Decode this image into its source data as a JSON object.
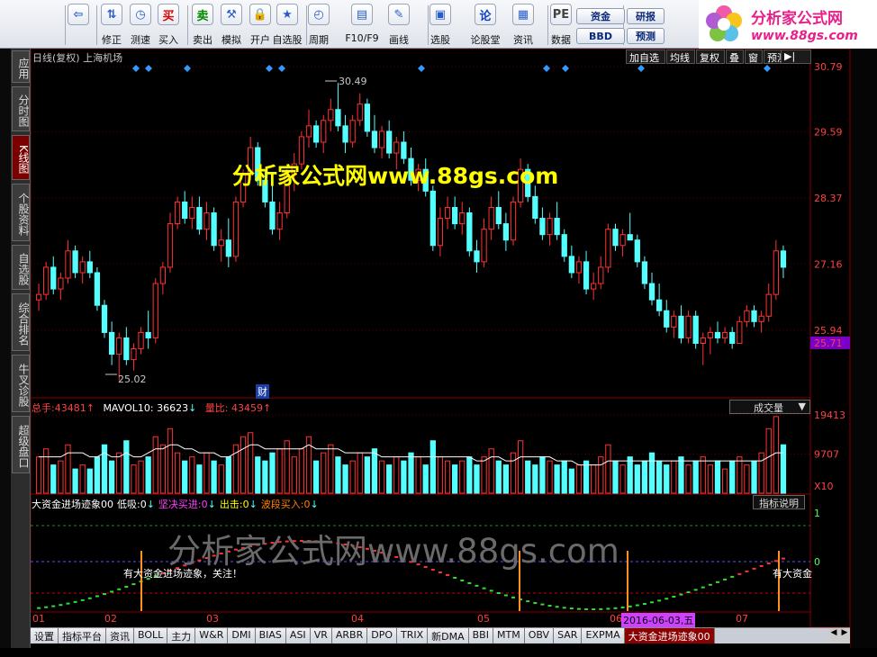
{
  "toolbar": {
    "buttons": [
      {
        "label": "",
        "icon": "back-arrow"
      },
      {
        "label": "修正",
        "icon": "up-down-arrows"
      },
      {
        "label": "测速",
        "icon": "clock"
      },
      {
        "label": "买入",
        "icon": "买"
      },
      {
        "label": "卖出",
        "icon": "卖"
      },
      {
        "label": "模拟",
        "icon": "hammer"
      },
      {
        "label": "开户",
        "icon": "lock"
      },
      {
        "label": "自选股",
        "icon": "star-folder"
      },
      {
        "label": "周期",
        "icon": "clock-dropdown"
      },
      {
        "label": "F10/F9",
        "icon": "document"
      },
      {
        "label": "画线",
        "icon": "pencil"
      },
      {
        "label": "选股",
        "icon": "monitor"
      },
      {
        "label": "论股堂",
        "icon": "论"
      },
      {
        "label": "资讯",
        "icon": "news"
      },
      {
        "label": "数据",
        "icon": "PE"
      }
    ],
    "pill_zijin": "资金",
    "pill_bbd": "BBD",
    "pill_yanbao": "研报",
    "pill_yuce": "预测",
    "pe_label": "PE"
  },
  "logo": {
    "title": "分析家公式网",
    "url": "www.88gs.com"
  },
  "sidebar": [
    "应用",
    "分时图",
    "K线图",
    "个股资料",
    "自选股",
    "综合排名",
    "牛叉诊股",
    "超级盘口"
  ],
  "chart_header": {
    "title": "日线(复权) 上海机场",
    "buttons": [
      "加自选",
      "均线",
      "复权",
      "叠",
      "窗",
      "预测"
    ]
  },
  "watermark_top": "分析家公式网www.88gs.com",
  "watermark_mid": "分析家公式网www.88gs.com",
  "price_labels": {
    "high": "30.49",
    "low": "25.02"
  },
  "cai_badge": "财",
  "volume_header": {
    "zongshou_label": "总手:",
    "zongshou": "43481",
    "mavol_label": "MAVOL10:",
    "mavol": "36623",
    "liangbi_label": "量比:",
    "liangbi": "43459",
    "select": "成交量"
  },
  "indicator_header": {
    "name": "大资金进场迹象00",
    "items": [
      {
        "label": "低吸:",
        "value": "0",
        "color": "#ffffff"
      },
      {
        "label": "坚决买进:",
        "value": "0",
        "color": "#ff40ff"
      },
      {
        "label": "出击:",
        "value": "0",
        "color": "#ffff00"
      },
      {
        "label": "波段买入:",
        "value": "0",
        "color": "#ff8000"
      }
    ],
    "help": "指标说明"
  },
  "indicator_notes": {
    "note1": "有大资金进场迹象，关注！",
    "note2": "有大资金"
  },
  "x_axis": {
    "months": [
      "01",
      "02",
      "03",
      "04",
      "05",
      "06",
      "07"
    ],
    "cursor_date": "2016-06-03,五"
  },
  "tabs": [
    "设置",
    "指标平台",
    "资讯",
    "BOLL",
    "主力",
    "W&R",
    "DMI",
    "BIAS",
    "ASI",
    "VR",
    "ARBR",
    "DPO",
    "TRIX",
    "新DMA",
    "BBI",
    "MTM",
    "OBV",
    "SAR",
    "EXPMA",
    "大资金进场迹象00"
  ],
  "chart_data": {
    "type": "candlestick",
    "title": "日线(复权) 上海机场",
    "price_axis": {
      "ticks": [
        "30.79",
        "29.59",
        "28.37",
        "27.16",
        "25.94"
      ],
      "current": "25.71"
    },
    "volume_axis": {
      "ticks": [
        "19413",
        "9707"
      ],
      "unit": "X10"
    },
    "indicator_axis": {
      "ticks": [
        "1",
        "0"
      ]
    },
    "x_labels": [
      "01",
      "02",
      "03",
      "04",
      "05",
      "06",
      "07"
    ],
    "high": 30.49,
    "low": 25.02,
    "candles": [
      [
        26.5,
        26.8,
        26.3,
        26.6
      ],
      [
        26.6,
        27.2,
        26.5,
        27.1
      ],
      [
        27.1,
        27.3,
        26.6,
        26.7
      ],
      [
        26.7,
        27.0,
        26.5,
        26.9
      ],
      [
        26.9,
        27.6,
        26.8,
        27.4
      ],
      [
        27.4,
        27.5,
        26.9,
        27.0
      ],
      [
        27.0,
        27.3,
        26.8,
        27.2
      ],
      [
        27.2,
        27.4,
        26.9,
        27.0
      ],
      [
        27.0,
        27.1,
        26.3,
        26.4
      ],
      [
        26.4,
        26.5,
        25.8,
        25.9
      ],
      [
        25.9,
        26.1,
        25.3,
        25.5
      ],
      [
        25.5,
        25.9,
        25.02,
        25.8
      ],
      [
        25.8,
        26.0,
        25.3,
        25.4
      ],
      [
        25.4,
        25.7,
        25.2,
        25.6
      ],
      [
        25.6,
        26.0,
        25.5,
        25.9
      ],
      [
        25.9,
        26.3,
        25.6,
        25.8
      ],
      [
        25.8,
        26.9,
        25.7,
        26.8
      ],
      [
        26.8,
        27.2,
        26.6,
        27.1
      ],
      [
        27.1,
        28.1,
        27.0,
        27.9
      ],
      [
        27.9,
        28.4,
        27.8,
        28.3
      ],
      [
        28.3,
        28.5,
        27.9,
        28.0
      ],
      [
        28.0,
        28.4,
        27.8,
        28.2
      ],
      [
        28.2,
        28.4,
        27.7,
        27.8
      ],
      [
        27.8,
        28.3,
        27.6,
        28.1
      ],
      [
        28.1,
        28.2,
        27.4,
        27.5
      ],
      [
        27.5,
        27.8,
        27.2,
        27.6
      ],
      [
        27.6,
        28.0,
        27.1,
        27.3
      ],
      [
        27.3,
        28.4,
        27.2,
        28.3
      ],
      [
        28.3,
        28.9,
        28.2,
        28.8
      ],
      [
        28.8,
        29.5,
        28.7,
        29.3
      ],
      [
        29.3,
        29.4,
        28.6,
        28.7
      ],
      [
        28.7,
        28.9,
        28.2,
        28.3
      ],
      [
        28.3,
        28.8,
        27.7,
        27.8
      ],
      [
        27.8,
        28.3,
        27.6,
        28.1
      ],
      [
        28.1,
        28.9,
        28.0,
        28.8
      ],
      [
        28.8,
        29.2,
        28.5,
        29.0
      ],
      [
        29.0,
        29.6,
        28.9,
        29.5
      ],
      [
        29.5,
        30.0,
        29.3,
        29.7
      ],
      [
        29.7,
        29.8,
        29.3,
        29.4
      ],
      [
        29.4,
        29.9,
        29.2,
        29.8
      ],
      [
        29.8,
        30.2,
        29.6,
        30.0
      ],
      [
        30.0,
        30.49,
        29.6,
        29.7
      ],
      [
        29.7,
        29.9,
        29.2,
        29.4
      ],
      [
        29.4,
        29.9,
        29.3,
        29.8
      ],
      [
        29.8,
        30.3,
        29.7,
        30.1
      ],
      [
        30.1,
        30.2,
        29.5,
        29.6
      ],
      [
        29.6,
        29.9,
        29.2,
        29.3
      ],
      [
        29.3,
        29.7,
        29.1,
        29.6
      ],
      [
        29.6,
        29.8,
        29.1,
        29.2
      ],
      [
        29.2,
        29.5,
        28.9,
        29.4
      ],
      [
        29.4,
        29.6,
        29.0,
        29.1
      ],
      [
        29.1,
        29.3,
        28.6,
        28.7
      ],
      [
        28.7,
        29.0,
        28.5,
        28.9
      ],
      [
        28.9,
        29.1,
        28.4,
        28.5
      ],
      [
        28.5,
        28.6,
        27.4,
        27.5
      ],
      [
        27.5,
        28.2,
        27.3,
        28.0
      ],
      [
        28.0,
        28.4,
        27.8,
        28.2
      ],
      [
        28.2,
        28.4,
        27.8,
        27.9
      ],
      [
        27.9,
        28.3,
        27.7,
        28.1
      ],
      [
        28.1,
        28.2,
        27.3,
        27.4
      ],
      [
        27.4,
        27.6,
        27.0,
        27.2
      ],
      [
        27.2,
        28.0,
        27.1,
        27.8
      ],
      [
        27.8,
        28.4,
        27.6,
        28.2
      ],
      [
        28.2,
        28.5,
        27.8,
        27.9
      ],
      [
        27.9,
        28.1,
        27.4,
        27.6
      ],
      [
        27.6,
        28.4,
        27.5,
        28.3
      ],
      [
        28.3,
        29.1,
        28.2,
        28.9
      ],
      [
        28.9,
        29.0,
        28.3,
        28.4
      ],
      [
        28.4,
        28.6,
        27.9,
        28.0
      ],
      [
        28.0,
        28.2,
        27.6,
        27.7
      ],
      [
        27.7,
        28.1,
        27.5,
        28.0
      ],
      [
        28.0,
        28.3,
        27.6,
        27.7
      ],
      [
        27.7,
        27.8,
        27.2,
        27.3
      ],
      [
        27.3,
        27.5,
        26.9,
        27.0
      ],
      [
        27.0,
        27.3,
        26.8,
        27.2
      ],
      [
        27.2,
        27.4,
        26.6,
        26.7
      ],
      [
        26.7,
        27.0,
        26.5,
        26.8
      ],
      [
        26.8,
        27.3,
        26.7,
        27.1
      ],
      [
        27.1,
        27.9,
        27.0,
        27.8
      ],
      [
        27.8,
        27.9,
        27.4,
        27.5
      ],
      [
        27.5,
        27.8,
        27.3,
        27.7
      ],
      [
        27.7,
        28.1,
        27.6,
        27.6
      ],
      [
        27.6,
        27.7,
        27.1,
        27.2
      ],
      [
        27.2,
        27.3,
        26.7,
        26.8
      ],
      [
        26.8,
        27.0,
        26.4,
        26.5
      ],
      [
        26.5,
        26.8,
        26.2,
        26.3
      ],
      [
        26.3,
        26.5,
        25.9,
        26.0
      ],
      [
        26.0,
        26.3,
        25.8,
        26.2
      ],
      [
        26.2,
        26.4,
        25.7,
        25.8
      ],
      [
        25.8,
        26.3,
        25.7,
        26.2
      ],
      [
        26.2,
        26.3,
        25.6,
        25.7
      ],
      [
        25.7,
        25.9,
        25.3,
        25.8
      ],
      [
        25.8,
        26.0,
        25.5,
        25.9
      ],
      [
        25.9,
        26.1,
        25.7,
        25.8
      ],
      [
        25.8,
        26.0,
        25.7,
        25.9
      ],
      [
        25.9,
        26.0,
        25.6,
        25.7
      ],
      [
        25.7,
        26.2,
        25.7,
        26.1
      ],
      [
        26.1,
        26.4,
        26.0,
        26.3
      ],
      [
        26.3,
        26.4,
        26.0,
        26.1
      ],
      [
        26.1,
        26.3,
        25.9,
        26.2
      ],
      [
        26.2,
        26.8,
        26.1,
        26.6
      ],
      [
        26.6,
        27.6,
        26.5,
        27.4
      ],
      [
        27.4,
        27.5,
        26.9,
        27.1
      ]
    ],
    "volumes": [
      9,
      11,
      7,
      8,
      12,
      6,
      7,
      6,
      9,
      12,
      8,
      10,
      13,
      7,
      8,
      9,
      14,
      12,
      16,
      10,
      8,
      9,
      7,
      10,
      8,
      7,
      9,
      12,
      14,
      15,
      9,
      8,
      10,
      11,
      13,
      9,
      11,
      14,
      8,
      10,
      12,
      9,
      7,
      8,
      10,
      9,
      11,
      8,
      7,
      9,
      8,
      10,
      9,
      7,
      13,
      9,
      8,
      7,
      8,
      9,
      7,
      9,
      11,
      8,
      7,
      10,
      13,
      8,
      7,
      9,
      8,
      7,
      8,
      6,
      7,
      8,
      7,
      9,
      12,
      8,
      7,
      9,
      7,
      8,
      10,
      8,
      7,
      8,
      9,
      7,
      8,
      9,
      7,
      8,
      6,
      8,
      9,
      7,
      8,
      10,
      16,
      19,
      12
    ],
    "mavol": [
      9,
      9,
      9,
      9,
      10,
      10,
      10,
      9,
      9,
      10,
      9,
      9,
      10,
      9,
      9,
      10,
      11,
      11,
      12,
      12,
      11,
      11,
      10,
      10,
      10,
      9,
      9,
      10,
      11,
      12,
      12,
      11,
      11,
      11,
      11,
      11,
      11,
      12,
      11,
      11,
      11,
      11,
      10,
      10,
      10,
      10,
      10,
      9,
      9,
      9,
      9,
      9,
      9,
      9,
      9,
      9,
      9,
      9,
      9,
      9,
      8,
      8,
      9,
      9,
      8,
      8,
      9,
      9,
      9,
      9,
      9,
      8,
      8,
      8,
      7,
      7,
      7,
      7,
      8,
      8,
      8,
      8,
      8,
      8,
      8,
      8,
      8,
      8,
      8,
      8,
      8,
      8,
      8,
      8,
      8,
      8,
      8,
      8,
      8,
      8,
      9,
      10,
      10
    ]
  }
}
